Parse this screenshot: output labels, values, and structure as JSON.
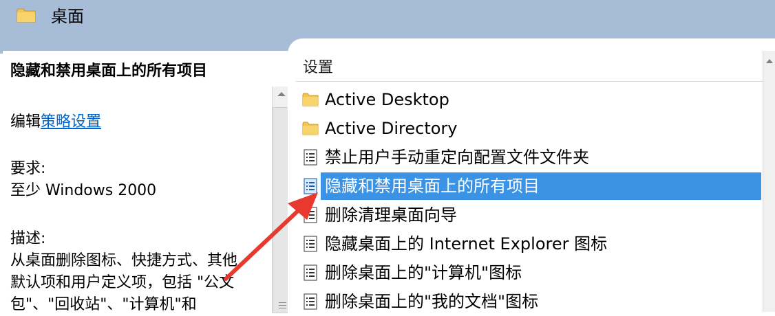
{
  "header": {
    "title": "桌面",
    "icon": "folder-icon"
  },
  "left_pane": {
    "policy_title": "隐藏和禁用桌面上的所有项目",
    "edit_prefix": "编辑",
    "edit_link": "策略设置",
    "requirements_label": "要求:",
    "requirements_value": "至少 Windows 2000",
    "description_label": "描述:",
    "description_lines": [
      "从桌面删除图标、快捷方式、其他",
      "默认项和用户定义项，包括 \"公文",
      "包\"、\"回收站\"、\"计算机\"和"
    ]
  },
  "settings": {
    "column_header": "设置",
    "rows": [
      {
        "label": "Active Desktop",
        "icon": "folder-icon",
        "selected": false
      },
      {
        "label": "Active Directory",
        "icon": "folder-icon",
        "selected": false
      },
      {
        "label": "禁止用户手动重定向配置文件文件夹",
        "icon": "policy-setting-icon",
        "selected": false
      },
      {
        "label": "隐藏和禁用桌面上的所有项目",
        "icon": "policy-setting-icon",
        "selected": true
      },
      {
        "label": "删除清理桌面向导",
        "icon": "policy-setting-icon",
        "selected": false
      },
      {
        "label": "隐藏桌面上的 Internet Explorer 图标",
        "icon": "policy-setting-icon",
        "selected": false
      },
      {
        "label": "删除桌面上的\"计算机\"图标",
        "icon": "policy-setting-icon",
        "selected": false
      },
      {
        "label": "删除桌面上的\"我的文档\"图标",
        "icon": "policy-setting-icon",
        "selected": false
      }
    ]
  },
  "colors": {
    "header_bg": "#a6bcd7",
    "selection": "#3b93e6",
    "link": "#0066cc",
    "annotation_arrow": "#e8392f"
  }
}
